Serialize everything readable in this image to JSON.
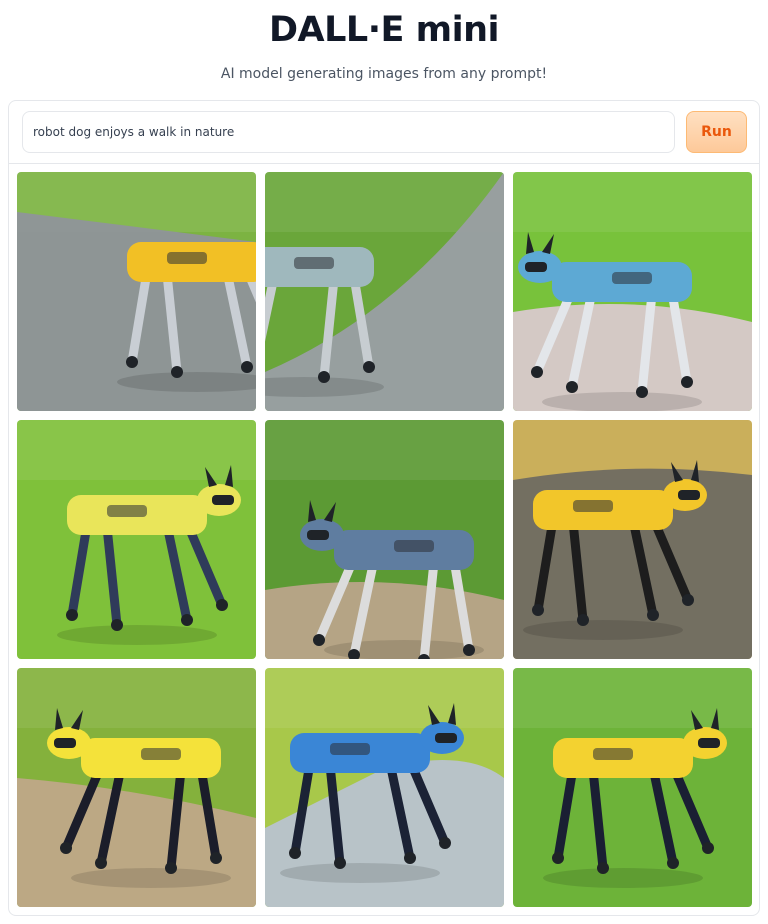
{
  "header": {
    "title": "DALL·E mini",
    "subtitle": "AI model generating images from any prompt!"
  },
  "prompt": {
    "value": "robot dog enjoys a walk in nature",
    "run_label": "Run"
  },
  "gallery": {
    "images": [
      {
        "grass": "#7cb342",
        "path": "#8f949a",
        "body": "#f2c025",
        "legs": "#c9ced4"
      },
      {
        "grass": "#6aa63a",
        "path": "#9a9ea4",
        "body": "#9fb8bd",
        "legs": "#c7cdd1"
      },
      {
        "grass": "#78c23b",
        "path": "#d9c9cc",
        "body": "#5da9d4",
        "legs": "#e3e6ea"
      },
      {
        "grass": "#7fc13a",
        "path": "#7fc13a",
        "body": "#e9e55a",
        "legs": "#2f3b5a"
      },
      {
        "grass": "#5c9a34",
        "path": "#b9a48a",
        "body": "#5f7da0",
        "legs": "#dcdcdc"
      },
      {
        "grass": "#c6a94e",
        "path": "#6f6b62",
        "body": "#f2c62a",
        "legs": "#1d1d1d"
      },
      {
        "grass": "#84b13c",
        "path": "#bfa888",
        "body": "#f4e23a",
        "legs": "#1b1d2a"
      },
      {
        "grass": "#a8c84a",
        "path": "#b8c3cf",
        "body": "#3a86d6",
        "legs": "#1b2235"
      },
      {
        "grass": "#6db339",
        "path": "#6db339",
        "body": "#f3d230",
        "legs": "#1a1f33"
      }
    ]
  }
}
